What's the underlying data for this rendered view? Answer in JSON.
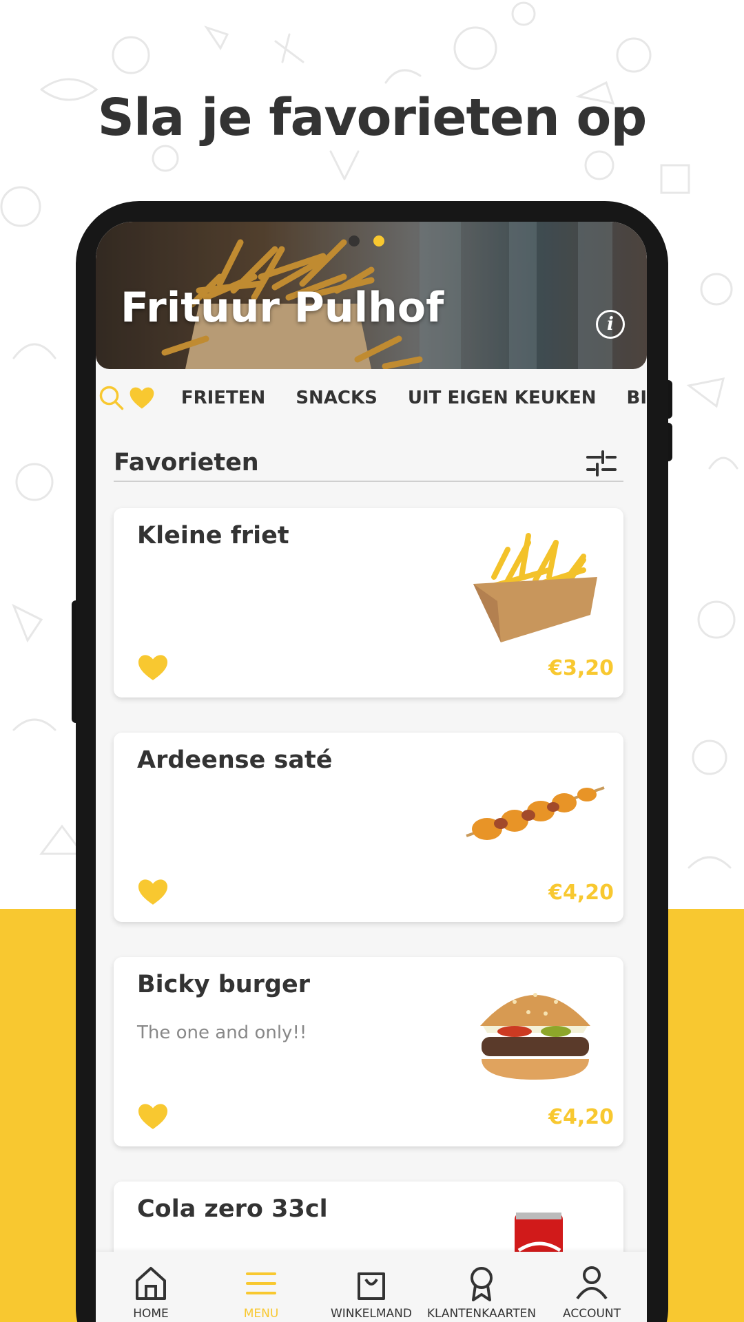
{
  "headline": "Sla je favorieten op",
  "colors": {
    "accent": "#f8c830",
    "text": "#333333",
    "frame": "#171717",
    "screen_bg": "#f6f6f6",
    "price": "#f8c830"
  },
  "restaurant": {
    "name": "Frituur Pulhof",
    "carousel": {
      "pages": 2,
      "active": 2
    }
  },
  "category_bar": {
    "icons": [
      "search-icon",
      "heart-icon"
    ],
    "categories": [
      "FRIETEN",
      "SNACKS",
      "UIT EIGEN KEUKEN",
      "BI"
    ]
  },
  "section": {
    "title": "Favorieten",
    "filter_icon": "sliders-icon"
  },
  "items": [
    {
      "name": "Kleine friet",
      "description": "",
      "price": "€3,20",
      "favorite": true,
      "image": "fries-box-image"
    },
    {
      "name": "Ardeense saté",
      "description": "",
      "price": "€4,20",
      "favorite": true,
      "image": "skewer-image"
    },
    {
      "name": "Bicky burger",
      "description": "The one and only!!",
      "price": "€4,20",
      "favorite": true,
      "image": "burger-image"
    },
    {
      "name": "Cola zero 33cl",
      "description": "",
      "price": "",
      "favorite": true,
      "image": "cola-can-image"
    }
  ],
  "bottom_nav": [
    {
      "label": "HOME",
      "icon": "home-icon",
      "active": false
    },
    {
      "label": "MENU",
      "icon": "menu-icon",
      "active": true
    },
    {
      "label": "WINKELMAND",
      "icon": "shopping-bag-icon",
      "active": false
    },
    {
      "label": "KLANTENKAARTEN",
      "icon": "award-icon",
      "active": false
    },
    {
      "label": "ACCOUNT",
      "icon": "user-icon",
      "active": false
    }
  ]
}
